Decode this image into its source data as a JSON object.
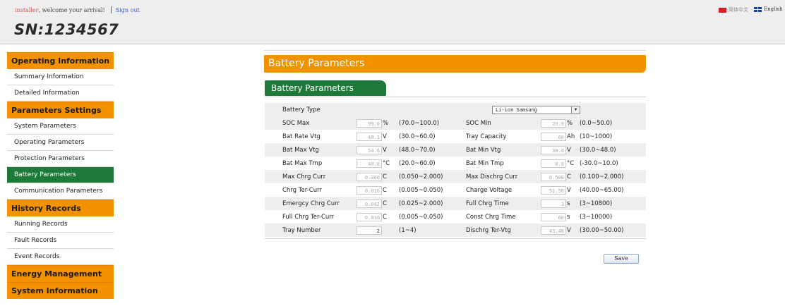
{
  "header": {
    "user": "installer",
    "welcome": ", welcome your arrival!",
    "sign_out": "Sign out",
    "serial": "SN:1234567",
    "lang_cn": "简体中文",
    "lang_en": "English"
  },
  "sidebar": {
    "operating_information": "Operating Information",
    "summary_information": "Summary Information",
    "detailed_information": "Detailed Information",
    "parameters_settings": "Parameters Settings",
    "system_parameters": "System Parameters",
    "operating_parameters": "Operating Parameters",
    "protection_parameters": "Protection Parameters",
    "battery_parameters": "Battery Parameters",
    "communication_parameters": "Communication Parameters",
    "history_records": "History Records",
    "running_records": "Running Records",
    "fault_records": "Fault Records",
    "event_records": "Event Records",
    "energy_management": "Energy Management",
    "system_information": "System Information"
  },
  "page": {
    "title": "Battery Parameters",
    "section": "Battery Parameters",
    "save_label": "Save"
  },
  "battery_type": {
    "label": "Battery Type",
    "selected": "Li-ion Samsung"
  },
  "rows": [
    {
      "l1": "SOC Max",
      "v1": "99.0",
      "u1": "%",
      "r1": "(70.0~100.0)",
      "l2": "SOC Min",
      "v2": "20.0",
      "u2": "%",
      "r2": "(0.0~50.0)"
    },
    {
      "l1": "Bat Rate Vtg",
      "v1": "48.1",
      "u1": "V",
      "r1": "(30.0~60.0)",
      "l2": "Tray Capacity",
      "v2": "60",
      "u2": "Ah",
      "r2": "(10~1000)"
    },
    {
      "l1": "Bat Max Vtg",
      "v1": "54.6",
      "u1": "V",
      "r1": "(48.0~70.0)",
      "l2": "Bat Min Vtg",
      "v2": "38.0",
      "u2": "V",
      "r2": "(30.0~48.0)"
    },
    {
      "l1": "Bat Max Tmp",
      "v1": "40.0",
      "u1": "°C",
      "r1": "(20.0~60.0)",
      "l2": "Bat Min Tmp",
      "v2": "0.0",
      "u2": "°C",
      "r2": "(-30.0~10.0)"
    },
    {
      "l1": "Max Chrg Curr",
      "v1": "0.300",
      "u1": "C",
      "r1": "(0.050~2.000)",
      "l2": "Max Dischrg Curr",
      "v2": "0.500",
      "u2": "C",
      "r2": "(0.100~2.000)"
    },
    {
      "l1": "Chrg Ter-Curr",
      "v1": "0.010",
      "u1": "C",
      "r1": "(0.005~0.050)",
      "l2": "Charge Voltage",
      "v2": "51.56",
      "u2": "V",
      "r2": "(40.00~65.00)"
    },
    {
      "l1": "Emergcy Chrg Curr",
      "v1": "0.042",
      "u1": "C",
      "r1": "(0.025~2.000)",
      "l2": "Full Chrg Time",
      "v2": "3",
      "u2": "s",
      "r2": "(3~10800)"
    },
    {
      "l1": "Full Chrg Ter-Curr",
      "v1": "0.010",
      "u1": "C",
      "r1": "(0.005~0.050)",
      "l2": "Const Chrg Time",
      "v2": "60",
      "u2": "s",
      "r2": "(3~10000)"
    },
    {
      "l1": "Tray Number",
      "v1": "2",
      "u1": "",
      "r1": "(1~4)",
      "l2": "Dischrg Ter-Vtg",
      "v2": "43.48",
      "u2": "V",
      "r2": "(30.00~50.00)"
    }
  ]
}
